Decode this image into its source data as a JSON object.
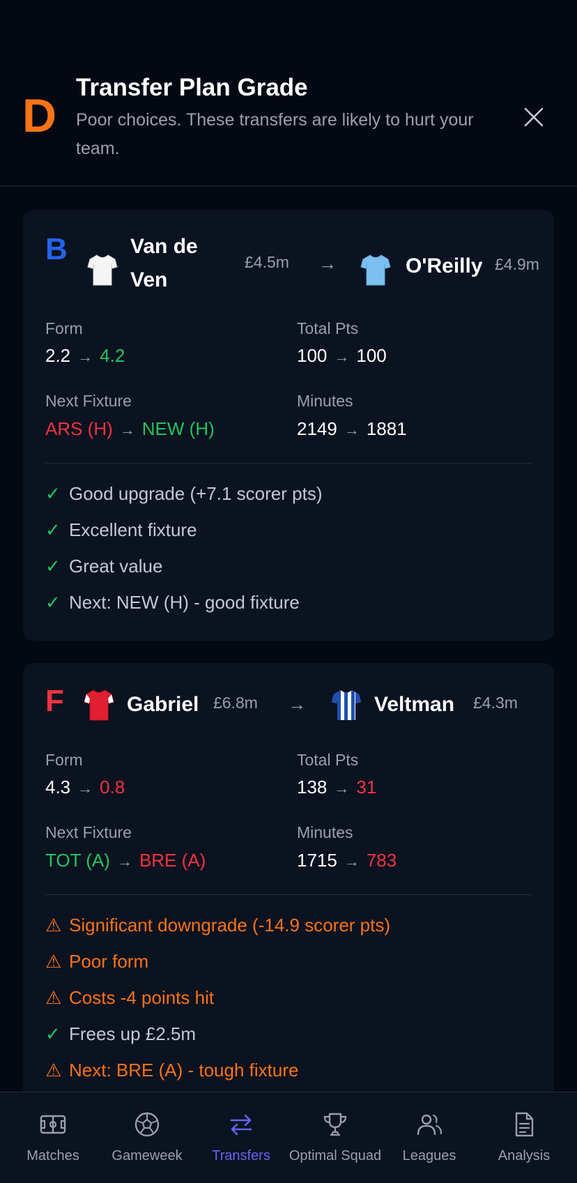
{
  "header": {
    "grade": "D",
    "grade_color": "#f97316",
    "title": "Transfer Plan Grade",
    "description": "Poor choices. These transfers are likely to hurt your team.",
    "close_icon": "close-icon"
  },
  "transfers": [
    {
      "grade": "B",
      "grade_color": "#2563eb",
      "out": {
        "name_line1": "Van de",
        "name_line2": "Ven",
        "price": "£4.5m",
        "shirt": "white-shirt-icon"
      },
      "arrow": "→",
      "in": {
        "name": "O'Reilly",
        "price": "£4.9m",
        "shirt": "sky-blue-shirt-icon"
      },
      "form": {
        "label": "Form",
        "from": "2.2",
        "to": "4.2"
      },
      "total_pts": {
        "label": "Total Pts",
        "from": "100",
        "to": "100"
      },
      "next_fixture": {
        "label": "Next Fixture",
        "from": "ARS (H)",
        "to": "NEW (H)"
      },
      "minutes": {
        "label": "Minutes",
        "from": "2149",
        "to": "1881"
      },
      "reasons": [
        {
          "icon": "✓",
          "type": "good",
          "text": "Good upgrade (+7.1 scorer pts)"
        },
        {
          "icon": "✓",
          "type": "good",
          "text": "Excellent fixture"
        },
        {
          "icon": "✓",
          "type": "good",
          "text": "Great value"
        },
        {
          "icon": "✓",
          "type": "good",
          "text": "Next: NEW (H) - good fixture"
        }
      ]
    },
    {
      "grade": "F",
      "grade_color": "#ef3340",
      "out": {
        "name": "Gabriel",
        "price": "£6.8m",
        "shirt": "red-shirt-icon"
      },
      "arrow": "→",
      "in": {
        "name": "Veltman",
        "price": "£4.3m",
        "shirt": "blue-white-striped-shirt-icon"
      },
      "form": {
        "label": "Form",
        "from": "4.3",
        "to": "0.8"
      },
      "total_pts": {
        "label": "Total Pts",
        "from": "138",
        "to": "31"
      },
      "next_fixture": {
        "label": "Next Fixture",
        "from": "TOT (A)",
        "to": "BRE (A)"
      },
      "minutes": {
        "label": "Minutes",
        "from": "1715",
        "to": "783"
      },
      "reasons": [
        {
          "icon": "⚠",
          "type": "warn",
          "text": "Significant downgrade (-14.9 scorer pts)"
        },
        {
          "icon": "⚠",
          "type": "warn",
          "text": "Poor form"
        },
        {
          "icon": "⚠",
          "type": "warn",
          "text": "Costs -4 points hit"
        },
        {
          "icon": "✓",
          "type": "good",
          "text": "Frees up £2.5m"
        },
        {
          "icon": "⚠",
          "type": "warn",
          "text": "Next: BRE (A) - tough fixture"
        }
      ]
    }
  ],
  "nav": {
    "active_color": "#6366f1",
    "items": [
      {
        "label": "Matches",
        "icon": "pitch-icon"
      },
      {
        "label": "Gameweek",
        "icon": "football-icon"
      },
      {
        "label": "Transfers",
        "icon": "swap-arrows-icon",
        "active": true
      },
      {
        "label": "Optimal Squad",
        "icon": "trophy-icon"
      },
      {
        "label": "Leagues",
        "icon": "users-icon"
      },
      {
        "label": "Analysis",
        "icon": "document-icon"
      }
    ]
  }
}
